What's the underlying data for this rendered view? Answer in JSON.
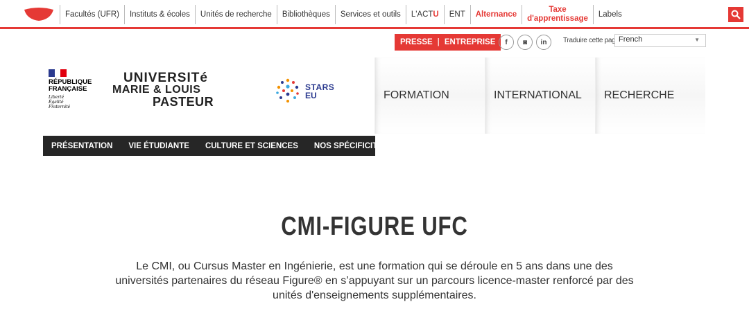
{
  "top_nav": {
    "items": [
      {
        "label": "Facultés (UFR)"
      },
      {
        "label": "Instituts & écoles"
      },
      {
        "label": "Unités de recherche"
      },
      {
        "label": "Bibliothèques"
      },
      {
        "label": "Services et outils"
      },
      {
        "label_main": "L'ACT",
        "label_accent": "U"
      },
      {
        "label": "ENT"
      },
      {
        "label": "Alternance"
      },
      {
        "label_line1": "Taxe",
        "label_line2": "d'apprentissage"
      },
      {
        "label": "Labels"
      }
    ]
  },
  "utility": {
    "presse": "PRESSE",
    "separator": "|",
    "entreprise": "ENTREPRISE",
    "social": [
      {
        "icon": "facebook-icon",
        "glyph": "f"
      },
      {
        "icon": "instagram-icon",
        "glyph": "◙"
      },
      {
        "icon": "linkedin-icon",
        "glyph": "in"
      }
    ],
    "translate_label": "Traduire cette page",
    "language_value": "French"
  },
  "logos": {
    "rf_line1": "RÉPUBLIQUE",
    "rf_line2": "FRANÇAISE",
    "rf_motto1": "Liberté",
    "rf_motto2": "Égalité",
    "rf_motto3": "Fraternité",
    "umlp_line1": "UNIVERSITé",
    "umlp_line2": "MARIE & LOUIS",
    "umlp_line3": "PASTEUR",
    "stars_line1": "STARS",
    "stars_line2": "EU"
  },
  "main_nav": {
    "items": [
      {
        "label": "FORMATION"
      },
      {
        "label": "INTERNATIONAL"
      },
      {
        "label": "RECHERCHE"
      }
    ]
  },
  "sub_nav": {
    "items": [
      {
        "label": "PRÉSENTATION"
      },
      {
        "label": "VIE ÉTUDIANTE"
      },
      {
        "label": "CULTURE ET SCIENCES"
      },
      {
        "label": "NOS SPÉCIFICITÉS"
      }
    ]
  },
  "hero": {
    "title": "CMI-FIGURE UFC",
    "description": "Le CMI, ou Cursus Master en Ingénierie, est une formation qui se déroule en 5 ans dans une des universités partenaires du réseau Figure® en s’appuyant sur un parcours licence-master renforcé par des unités d'enseignements supplémentaires."
  },
  "colors": {
    "accent": "#e53935",
    "dark_nav": "#262626",
    "flag_blue": "#2a3a8f",
    "flag_red": "#e1000f"
  }
}
